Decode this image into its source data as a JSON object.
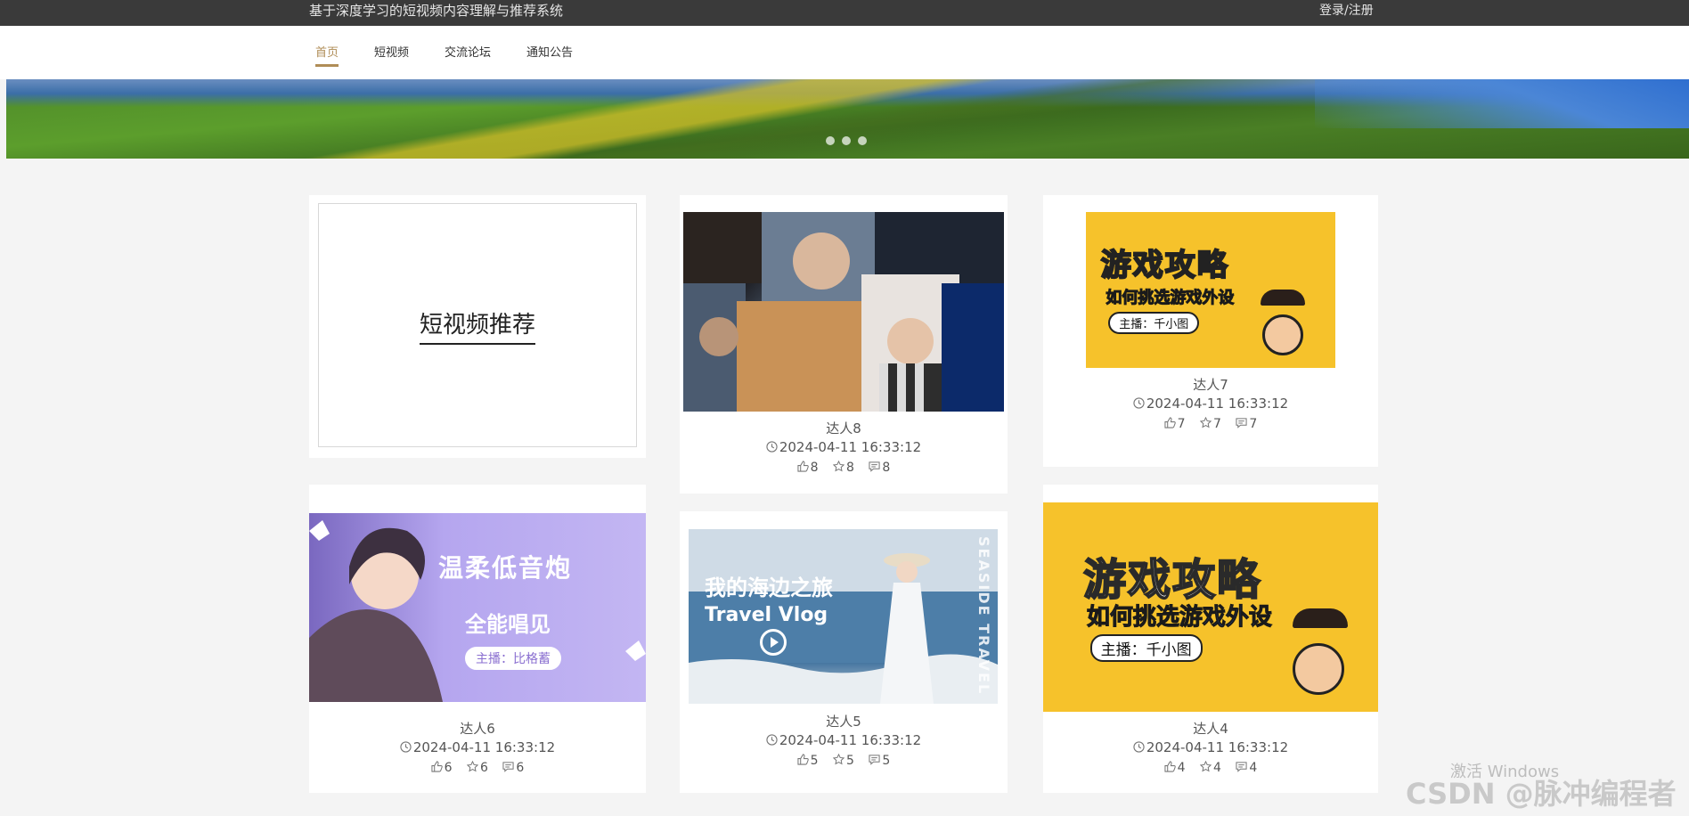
{
  "header": {
    "site_title": "基于深度学习的短视频内容理解与推荐系统",
    "login_label": "登录/注册"
  },
  "nav": {
    "items": [
      {
        "label": "首页",
        "active": true
      },
      {
        "label": "短视频",
        "active": false
      },
      {
        "label": "交流论坛",
        "active": false
      },
      {
        "label": "通知公告",
        "active": false
      }
    ]
  },
  "banner": {
    "slides": 3
  },
  "recommend": {
    "title": "短视频推荐"
  },
  "videos": [
    {
      "name": "达人8",
      "time": "2024-04-11 16:33:12",
      "likes": "8",
      "favorites": "8",
      "comments": "8"
    },
    {
      "name": "达人7",
      "time": "2024-04-11 16:33:12",
      "likes": "7",
      "favorites": "7",
      "comments": "7"
    },
    {
      "name": "达人6",
      "time": "2024-04-11 16:33:12",
      "likes": "6",
      "favorites": "6",
      "comments": "6"
    },
    {
      "name": "达人5",
      "time": "2024-04-11 16:33:12",
      "likes": "5",
      "favorites": "5",
      "comments": "5"
    },
    {
      "name": "达人4",
      "time": "2024-04-11 16:33:12",
      "likes": "4",
      "favorites": "4",
      "comments": "4"
    }
  ],
  "thumb_text": {
    "game_title": "游戏攻略",
    "game_sub": "如何挑选游戏外设",
    "game_host": "主播：千小图",
    "purple_t1": "温柔低音炮",
    "purple_t2": "全能唱见",
    "purple_host": "主播：比格蓄",
    "sea_t1": "我的海边之旅",
    "sea_t2": "Travel Vlog",
    "sea_side": "SEASIDE TRAVEL"
  },
  "watermark": {
    "activate": "激活 Windows",
    "csdn": "CSDN @脉冲编程者"
  },
  "colors": {
    "accent": "#b08d57",
    "topbar": "#3a3a3a"
  }
}
